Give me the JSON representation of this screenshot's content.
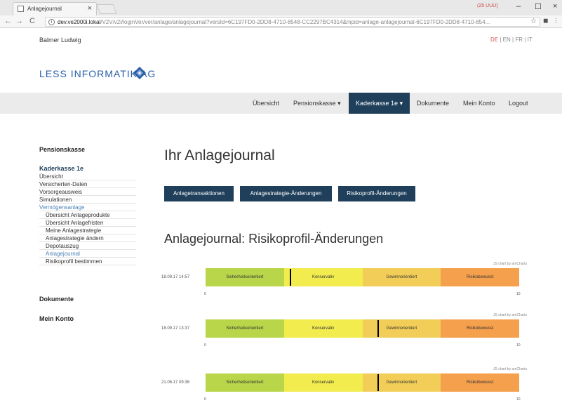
{
  "browser": {
    "tab_title": "Anlagejournal",
    "url_host": "dev.ve2000i.lokal",
    "url_path": "/V2V/v2i/loginVer/ver/anlage/anlagejournal?versId=6C197FD0-2DD8-4710-8548-CC2297BC4314&mpid=anlage-anlagejournal-6C197FD0-2DD8-4710-854...",
    "badge": "(25 UUU)"
  },
  "header": {
    "user": "Balmer Ludwig",
    "logo": "LESS INFORMATIK AG",
    "languages": [
      "DE",
      "EN",
      "FR",
      "IT"
    ],
    "active_language": "DE"
  },
  "navbar": {
    "items": [
      {
        "label": "Übersicht",
        "has_caret": false,
        "active": false
      },
      {
        "label": "Pensionskasse",
        "has_caret": true,
        "active": false
      },
      {
        "label": "Kaderkasse 1e",
        "has_caret": true,
        "active": true
      },
      {
        "label": "Dokumente",
        "has_caret": false,
        "active": false
      },
      {
        "label": "Mein Konto",
        "has_caret": false,
        "active": false
      },
      {
        "label": "Logout",
        "has_caret": false,
        "active": false
      }
    ]
  },
  "sidebar": {
    "pensionskasse": "Pensionskasse",
    "kaderkasse": "Kaderkasse 1e",
    "items": [
      {
        "label": "Übersicht",
        "link": false,
        "indent": false
      },
      {
        "label": "Versicherten-Daten",
        "link": false,
        "indent": false
      },
      {
        "label": "Vorsorgeausweis",
        "link": false,
        "indent": false
      },
      {
        "label": "Simulationen",
        "link": false,
        "indent": false
      },
      {
        "label": "Vermögensanlage",
        "link": true,
        "indent": false
      },
      {
        "label": "Übersicht Anlageprodukte",
        "link": false,
        "indent": true
      },
      {
        "label": "Übersicht Anlagefristen",
        "link": false,
        "indent": true
      },
      {
        "label": "Meine Anlagestrategie",
        "link": false,
        "indent": true
      },
      {
        "label": "Anlagestrategie ändern",
        "link": false,
        "indent": true
      },
      {
        "label": "Depotauszug",
        "link": false,
        "indent": true
      },
      {
        "label": "Anlagejournal",
        "link": true,
        "indent": true
      },
      {
        "label": "Risikoprofil bestimmen",
        "link": false,
        "indent": true
      }
    ],
    "dokumente": "Dokumente",
    "mein_konto": "Mein Konto"
  },
  "main": {
    "title": "Ihr Anlagejournal",
    "buttons": [
      "Anlagetransaktionen",
      "Anlagestrategie-Änderungen",
      "Risikoprofil-Änderungen"
    ],
    "section_title": "Anlagejournal: Risikoprofil-Änderungen"
  },
  "chart_data": {
    "type": "bar",
    "credit": "JS chart by amCharts",
    "axis_min": 0,
    "axis_max": 10,
    "bands": [
      {
        "label": "Sicherheitsorientiert",
        "from": 0,
        "to": 2.5,
        "color": "#b9d64a"
      },
      {
        "label": "Konservativ",
        "from": 2.5,
        "to": 5,
        "color": "#f2ec4e"
      },
      {
        "label": "Gewinnorientiert",
        "from": 5,
        "to": 7.5,
        "color": "#f2ce58"
      },
      {
        "label": "Risikobewusst",
        "from": 7.5,
        "to": 10,
        "color": "#f5a04d"
      }
    ],
    "rows": [
      {
        "date": "18.09.17 14:57",
        "value": 2.7
      },
      {
        "date": "18.09.17 13:37",
        "value": 5.5
      },
      {
        "date": "21.06.17 09:36",
        "value": 5.5
      }
    ]
  }
}
